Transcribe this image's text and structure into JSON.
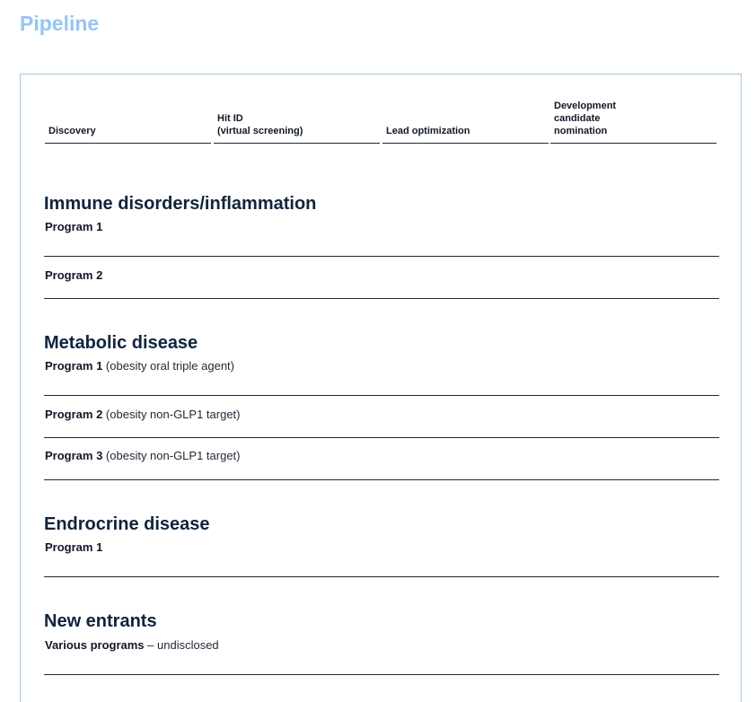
{
  "page": {
    "title": "Pipeline"
  },
  "stages": [
    "Discovery",
    "Hit ID\n(virtual screening)",
    "Lead optimization",
    "Development\ncandidate\nnomination"
  ],
  "sections": [
    {
      "title": "Immune disorders/inflammation",
      "programs": [
        {
          "name": "Program 1",
          "desc": ""
        },
        {
          "name": "Program 2",
          "desc": ""
        }
      ]
    },
    {
      "title": "Metabolic disease",
      "programs": [
        {
          "name": "Program 1",
          "desc": " (obesity oral triple agent)"
        },
        {
          "name": "Program 2",
          "desc": " (obesity non-GLP1 target)"
        },
        {
          "name": "Program 3",
          "desc": " (obesity non-GLP1 target)"
        }
      ]
    },
    {
      "title": "Endrocrine disease",
      "programs": [
        {
          "name": "Program 1",
          "desc": ""
        }
      ]
    },
    {
      "title": "New entrants",
      "programs": [
        {
          "name": "Various programs",
          "desc": " – undisclosed"
        }
      ]
    }
  ]
}
